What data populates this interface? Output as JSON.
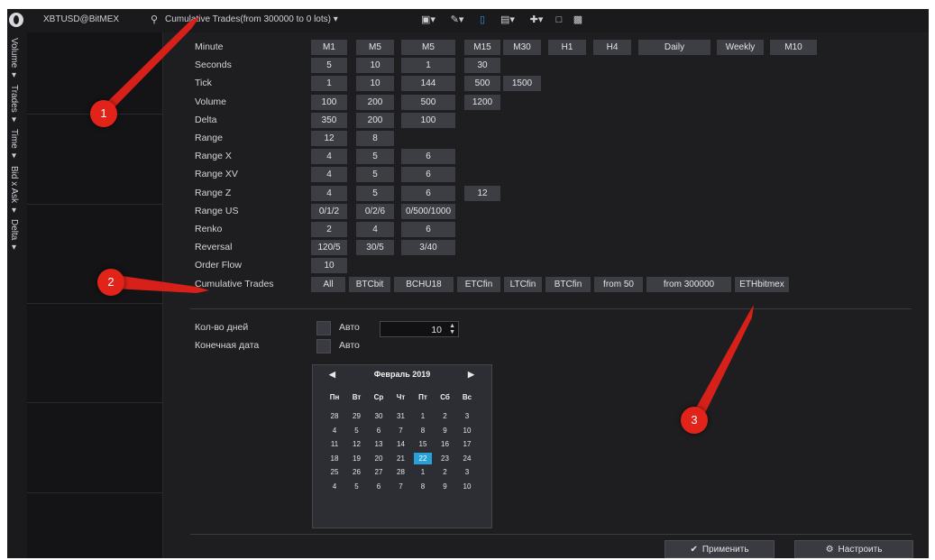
{
  "toolbar": {
    "instrument": "XBTUSD@BitMEX",
    "chart_type": "Cumulative Trades(from 300000 to 0 lots) ▾"
  },
  "side_panel": {
    "items": [
      "Volume ▾",
      "Trades ▾",
      "Time ▾",
      "Bid x Ask ▾",
      "Delta ▾"
    ]
  },
  "timeframes": {
    "rows": [
      {
        "label": "Minute",
        "cells": [
          "M1",
          "M5",
          "M5",
          "M15",
          "M30",
          "H1",
          "H4",
          "Daily",
          "Weekly",
          "M10"
        ]
      },
      {
        "label": "Seconds",
        "cells": [
          "5",
          "10",
          "1",
          "30"
        ]
      },
      {
        "label": "Tick",
        "cells": [
          "1",
          "10",
          "144",
          "500",
          "1500"
        ]
      },
      {
        "label": "Volume",
        "cells": [
          "100",
          "200",
          "500",
          "1200"
        ]
      },
      {
        "label": "Delta",
        "cells": [
          "350",
          "200",
          "100"
        ]
      },
      {
        "label": "Range",
        "cells": [
          "12",
          "8"
        ]
      },
      {
        "label": "Range X",
        "cells": [
          "4",
          "5",
          "6"
        ]
      },
      {
        "label": "Range XV",
        "cells": [
          "4",
          "5",
          "6"
        ]
      },
      {
        "label": "Range Z",
        "cells": [
          "4",
          "5",
          "6",
          "12"
        ]
      },
      {
        "label": "Range US",
        "cells": [
          "0/1/2",
          "0/2/6",
          "0/500/1000"
        ]
      },
      {
        "label": "Renko",
        "cells": [
          "2",
          "4",
          "6"
        ]
      },
      {
        "label": "Reversal",
        "cells": [
          "120/5",
          "30/5",
          "3/40"
        ]
      },
      {
        "label": "Order Flow",
        "cells": [
          "10"
        ]
      },
      {
        "label": "Cumulative Trades",
        "cells": [
          "All",
          "BTCbit",
          "BCHU18",
          "ETCfin",
          "LTCfin",
          "BTCfin",
          "from 50",
          "from 300000",
          "ETHbitmex"
        ]
      }
    ]
  },
  "settings": {
    "days_label": "Кол-во дней",
    "end_date_label": "Конечная дата",
    "auto_label_1": "Авто",
    "auto_label_2": "Авто",
    "days_value": "10"
  },
  "calendar": {
    "title": "Февраль 2019",
    "dow": [
      "Пн",
      "Вт",
      "Ср",
      "Чт",
      "Пт",
      "Сб",
      "Вс"
    ],
    "weeks": [
      [
        "28",
        "29",
        "30",
        "31",
        "1",
        "2",
        "3"
      ],
      [
        "4",
        "5",
        "6",
        "7",
        "8",
        "9",
        "10"
      ],
      [
        "11",
        "12",
        "13",
        "14",
        "15",
        "16",
        "17"
      ],
      [
        "18",
        "19",
        "20",
        "21",
        "22",
        "23",
        "24"
      ],
      [
        "25",
        "26",
        "27",
        "28",
        "1",
        "2",
        "3"
      ],
      [
        "4",
        "5",
        "6",
        "7",
        "8",
        "9",
        "10"
      ]
    ],
    "selected_day": "22"
  },
  "buttons": {
    "apply": "Применить",
    "configure": "Настроить"
  },
  "annotations": {
    "badges": [
      "1",
      "2",
      "3"
    ],
    "color": "#e2231a"
  },
  "colors": {
    "accent": "#28a0d8",
    "cell_bg": "#3d3e44",
    "panel_bg": "#1e1e21"
  }
}
